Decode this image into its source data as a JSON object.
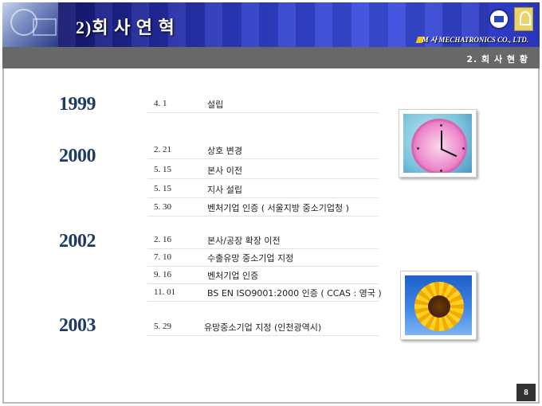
{
  "header": {
    "title": "2)회 사 연 혁",
    "company": "M 사 MECHATRONICS CO., LTD."
  },
  "subbar": {
    "section": "2. 회 사 현 황"
  },
  "history": [
    {
      "year": "1999",
      "events": [
        {
          "date": "4.  1",
          "desc": "설립"
        }
      ]
    },
    {
      "year": "2000",
      "events": [
        {
          "date": "2. 21",
          "desc": "상호 변경"
        },
        {
          "date": "5. 15",
          "desc": "본사 이전"
        },
        {
          "date": "5. 15",
          "desc": "지사 설립"
        },
        {
          "date": "5. 30",
          "desc": "벤처기업 인증 ( 서울지방 중소기업청 )"
        }
      ]
    },
    {
      "year": "2002",
      "events": [
        {
          "date": "2. 16",
          "desc": "본사/공장 확장 이전"
        },
        {
          "date": "7. 10",
          "desc": "수출유망 중소기업 지정"
        },
        {
          "date": "9. 16",
          "desc": "벤처기업 인증"
        },
        {
          "date": "11. 01",
          "desc": "BS EN ISO9001:2000 인증 ( CCAS  : 영국 )"
        }
      ]
    },
    {
      "year": "2003",
      "events": [
        {
          "date": "5. 29",
          "desc": "유망중소기업 지정 (인천광역시)"
        }
      ]
    }
  ],
  "page_number": "8",
  "icons": {
    "clock": "clock-photo",
    "sunflower": "sunflower-photo",
    "cert_left": "quality-cert-badge-icon",
    "cert_right": "quality-cert-mark-icon"
  }
}
